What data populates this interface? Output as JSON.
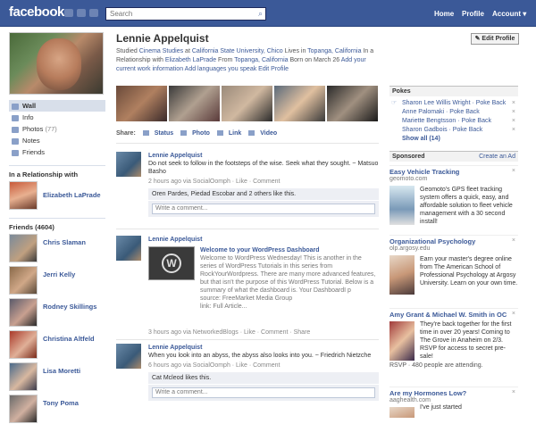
{
  "topbar": {
    "logo": "facebook",
    "search_placeholder": "Search",
    "nav": [
      "Home",
      "Profile",
      "Account ▾"
    ]
  },
  "left": {
    "nav": [
      {
        "label": "Wall",
        "count": ""
      },
      {
        "label": "Info",
        "count": ""
      },
      {
        "label": "Photos",
        "count": "(77)"
      },
      {
        "label": "Notes",
        "count": ""
      },
      {
        "label": "Friends",
        "count": ""
      }
    ],
    "relationship_heading": "In a Relationship with",
    "relationship_name": "Elizabeth LaPrade",
    "friends_heading": "Friends (4604)",
    "friends": [
      "Chris Slaman",
      "Jerri Kelly",
      "Rodney Skillings",
      "Christina Altfeld",
      "Lisa Moretti",
      "Tony Poma"
    ]
  },
  "main": {
    "name": "Lennie Appelquist",
    "edit_profile": "Edit Profile",
    "info_parts": [
      "Studied ",
      "Cinema Studies",
      " at ",
      "California State University, Chico",
      "  Lives in ",
      "Topanga, California",
      "  In a Relationship with ",
      "Elizabeth LaPrade",
      "  From ",
      "Topanga, California",
      "  Born on March 26  ",
      "Add your current work information",
      "  ",
      "Add languages you speak",
      "  ",
      "Edit Profile"
    ],
    "share_label": "Share:",
    "share_items": [
      "Status",
      "Photo",
      "Link",
      "Video"
    ],
    "posts": [
      {
        "author": "Lennie Appelquist",
        "text": "Do not seek to follow in the footsteps of the wise. Seek what they sought. ~ Matsuo Basho",
        "meta": "2 hours ago via SocialOomph · Like · Comment",
        "likes": "Oren Pardes, Piedad Escobar and 2 others like this.",
        "comment": "Write a comment..."
      },
      {
        "author": "Lennie Appelquist",
        "link_title": "Welcome to your WordPress Dashboard",
        "text": "Welcome to WordPress Wednesday! This is another in the series of WordPress Tutorials in this series from RockYourWordpress. There are many more advanced features, but that isn't the purpose of this WordPress Tutorial. Below is a summary of what the dashboard is. Your DashboardI p",
        "source": "source: FreeMarket Media Group",
        "full": "link: Full Article...",
        "meta": "3 hours ago via NetworkedBlogs · Like · Comment · Share"
      },
      {
        "author": "Lennie Appelquist",
        "text": "When you look into an abyss, the abyss also looks into you. ~ Friedrich Nietzche",
        "meta": "6 hours ago via SocialOomph · Like · Comment",
        "likes": "Cat Mcleod likes this.",
        "comment": "Write a comment..."
      }
    ]
  },
  "right": {
    "pokes_heading": "Pokes",
    "pokes": [
      "Sharon Lee Willis Wright · Poke Back",
      "Anne Palomaki · Poke Back",
      "Mariette Bengtsson · Poke Back",
      "Sharon Gadbois · Poke Back"
    ],
    "show_all": "Show all (14)",
    "sponsored": "Sponsored",
    "create_ad": "Create an Ad",
    "ads": [
      {
        "title": "Easy Vehicle Tracking",
        "domain": "geomoto.com",
        "text": "Geomoto's GPS fleet tracking system offers a quick, easy, and affordable solution to fleet vehicle management with a 30 second install!"
      },
      {
        "title": "Organizational Psychology",
        "domain": "olp.argosy.edu",
        "text": "Earn your master's degree online from The American School of Professional Psychology at Argosy University. Learn on your own time."
      },
      {
        "title": "Amy Grant & Michael W. Smith in OC",
        "domain": "",
        "text": "They're back together for the first time in over 20 years! Coming to The Grove in Anaheim on 2/3. RSVP for access to secret pre-sale!",
        "rsvp": "RSVP · 480 people are attending."
      },
      {
        "title": "Are my Hormones Low?",
        "domain": "aaghealth.com",
        "text": "I've just started"
      }
    ]
  }
}
